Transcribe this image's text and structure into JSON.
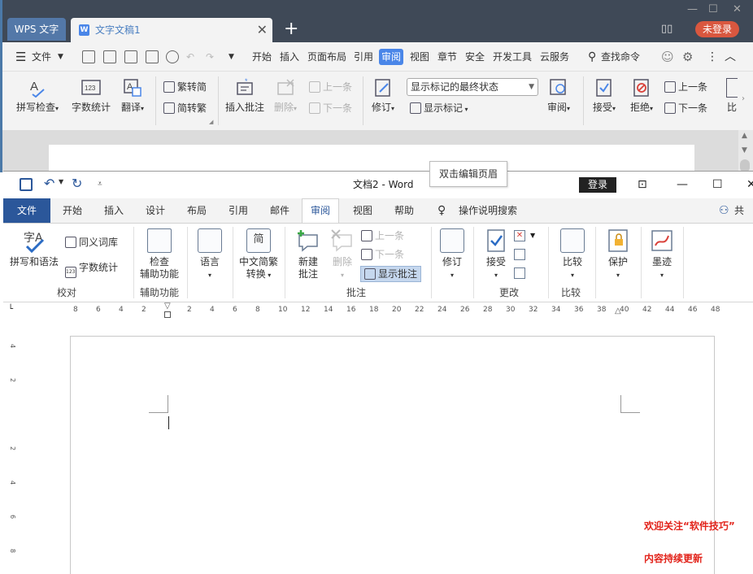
{
  "wps": {
    "app_tab": "WPS 文字",
    "doc_tab": "文字文稿1",
    "login": "未登录",
    "menu": {
      "file": "文件",
      "items": [
        "开始",
        "插入",
        "页面布局",
        "引用",
        "审阅",
        "视图",
        "章节",
        "安全",
        "开发工具",
        "云服务"
      ],
      "active": "审阅",
      "search": "查找命令"
    },
    "ribbon": {
      "spellcheck": "拼写检查",
      "wordcount": "字数统计",
      "translate": "翻译",
      "trad_to_simp": "繁转简",
      "simp_to_trad": "简转繁",
      "insert_comment": "插入批注",
      "delete": "删除",
      "prev": "上一条",
      "next": "下一条",
      "revise": "修订",
      "display_select": "显示标记的最终状态",
      "show_markup": "显示标记",
      "review": "审阅",
      "accept": "接受",
      "reject": "拒绝",
      "prev2": "上一条",
      "next2": "下一条",
      "compare": "比"
    }
  },
  "tooltip": "双击编辑页眉",
  "word": {
    "title": "文档2  -  Word",
    "login": "登录",
    "share": "共享",
    "tabs": {
      "file": "文件",
      "items": [
        "开始",
        "插入",
        "设计",
        "布局",
        "引用",
        "邮件",
        "审阅",
        "视图",
        "帮助"
      ],
      "active": "审阅",
      "tell_me": "操作说明搜索"
    },
    "ribbon": {
      "spelling": "拼写和语法",
      "thesaurus": "同义词库",
      "wordcount": "字数统计",
      "group_proofing": "校对",
      "check_accessibility_1": "检查",
      "check_accessibility_2": "辅助功能",
      "group_accessibility": "辅助功能",
      "language": "语言",
      "chinese_convert_1": "中文简繁",
      "chinese_convert_2": "转换",
      "new_comment_1": "新建",
      "new_comment_2": "批注",
      "delete": "删除",
      "prev": "上一条",
      "next": "下一条",
      "show_comments": "显示批注",
      "group_comments": "批注",
      "track": "修订",
      "accept": "接受",
      "group_changes": "更改",
      "compare": "比较",
      "group_compare": "比较",
      "protect": "保护",
      "ink": "墨迹"
    },
    "ruler_h": [
      "8",
      "6",
      "4",
      "2",
      "",
      "2",
      "4",
      "6",
      "8",
      "10",
      "12",
      "14",
      "16",
      "18",
      "20",
      "22",
      "24",
      "26",
      "28",
      "30",
      "32",
      "34",
      "36",
      "38",
      "40",
      "42",
      "44",
      "46",
      "48"
    ],
    "ruler_v": [
      "4",
      "2",
      "",
      "2",
      "4",
      "6",
      "8"
    ]
  },
  "overlay": {
    "line1": "欢迎关注“软件技巧”",
    "line2": "内容持续更新"
  }
}
